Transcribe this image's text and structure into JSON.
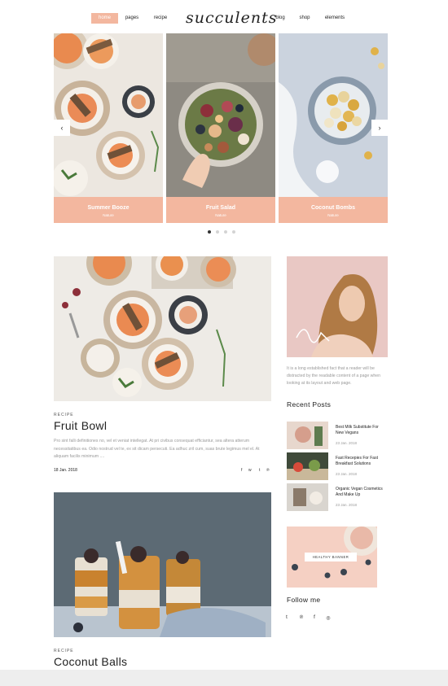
{
  "nav": {
    "left": [
      {
        "label": "home",
        "active": true
      },
      {
        "label": "pages",
        "active": false
      },
      {
        "label": "recipe",
        "active": false
      }
    ],
    "logo": "succulents",
    "right": [
      {
        "label": "blog"
      },
      {
        "label": "shop"
      },
      {
        "label": "elements"
      }
    ]
  },
  "slider": {
    "prev_icon": "chevron-left-icon",
    "next_icon": "chevron-right-icon",
    "prev_glyph": "‹",
    "next_glyph": "›",
    "slides": [
      {
        "title": "Summer Booze",
        "tag": "Nature"
      },
      {
        "title": "Fruit Salad",
        "tag": "Nature"
      },
      {
        "title": "Coconut Bombs",
        "tag": "Nature"
      }
    ],
    "dots_count": 4,
    "active_dot": 0
  },
  "posts": [
    {
      "category": "RECIPE",
      "title": "Fruit Bowl",
      "excerpt": "Pro sint falli definitiones no, vel et veniat intellegat. At pri civibus consequat efficiantur, sea altera atterum necessitatibus ea. Odio nostrud vel te, ex sit dicam persecuti. Ea adhuc zril cum, suas brute legimus mel el. At aliquam facilis minimum ....",
      "date": "18 Jan. 2018",
      "share": [
        "f",
        "ᴡ",
        "t",
        "℗"
      ]
    },
    {
      "category": "RECIPE",
      "title": "Coconut Balls"
    }
  ],
  "sidebar": {
    "about_text": "It is a long established fact that a reader will be distracted by the readable content of a page when looking at its layout and web page.",
    "recent_heading": "Recent Posts",
    "recent_posts": [
      {
        "title": "Best Milk Substitute For New Vegans",
        "date": "23 Jan. 2018"
      },
      {
        "title": "Fast Recepies For Fast Breakfast Solutions",
        "date": "23 Jan. 2018"
      },
      {
        "title": "Organic Vegan Cosmetics And Make Up",
        "date": "23 Jan. 2018"
      }
    ],
    "banner_label": "HEALTHY BANNER",
    "follow_heading": "Follow me",
    "social": [
      {
        "icon": "tumblr-icon",
        "glyph": "t"
      },
      {
        "icon": "pinterest-icon",
        "glyph": "℗"
      },
      {
        "icon": "facebook-icon",
        "glyph": "f"
      },
      {
        "icon": "instagram-icon",
        "glyph": "◎"
      }
    ]
  },
  "colors": {
    "accent": "#f3b79f",
    "banner_bg": "#f5d0c3"
  }
}
